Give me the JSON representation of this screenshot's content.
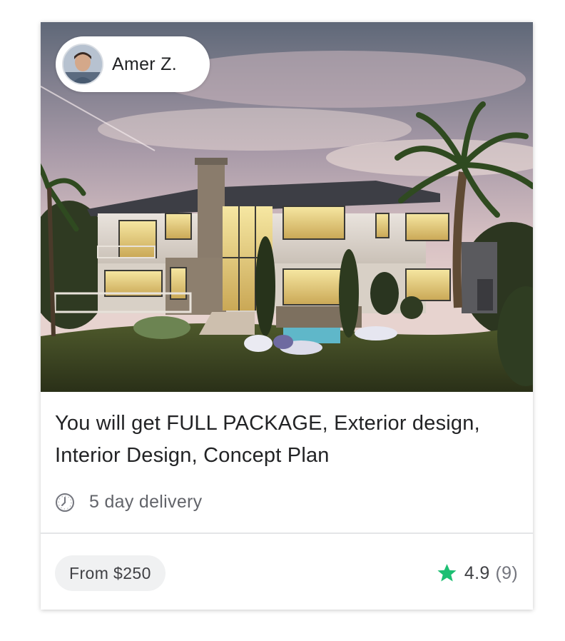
{
  "seller": {
    "name": "Amer Z."
  },
  "gig": {
    "title": "You will get FULL PACKAGE, Exterior design, Interior Design, Concept Plan",
    "delivery": "5 day delivery",
    "price": "From $250",
    "rating": "4.9",
    "review_count": "(9)"
  },
  "icons": {
    "delivery": "clock-icon",
    "rating": "star-icon"
  },
  "colors": {
    "star": "#1dbf73",
    "text_primary": "#222325",
    "text_secondary": "#62646a",
    "pill_bg": "#f0f1f2"
  }
}
